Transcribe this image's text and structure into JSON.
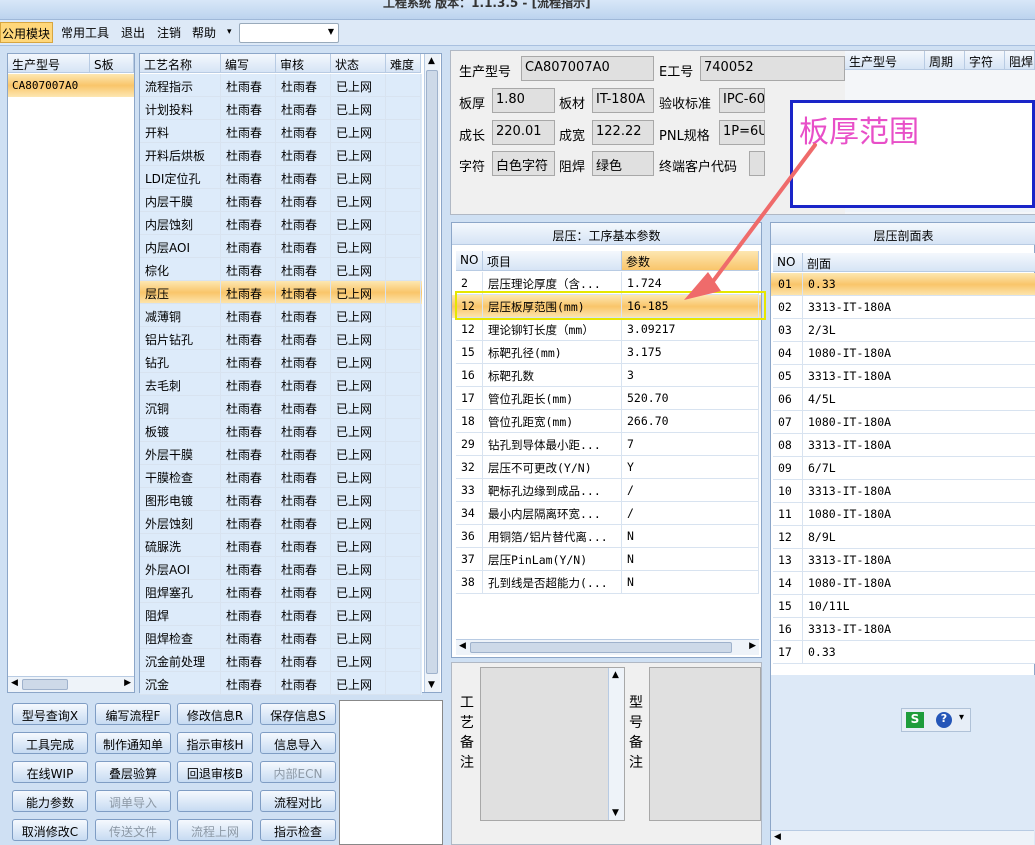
{
  "title": "工程系统 版本：1.1.3.5 - [流程指示]",
  "menu": {
    "items": [
      "公用模块",
      "常用工具",
      "退出",
      "注销",
      "帮助"
    ],
    "help_arrow": "▾"
  },
  "model_list": {
    "headers": [
      "生产型号",
      "S板"
    ],
    "items": [
      "CA807007A0"
    ]
  },
  "process": {
    "headers": [
      "工艺名称",
      "编写",
      "审核",
      "状态",
      "难度"
    ],
    "rows": [
      [
        "流程指示",
        "杜雨春",
        "杜雨春",
        "已上网"
      ],
      [
        "计划投料",
        "杜雨春",
        "杜雨春",
        "已上网"
      ],
      [
        "开料",
        "杜雨春",
        "杜雨春",
        "已上网"
      ],
      [
        "开料后烘板",
        "杜雨春",
        "杜雨春",
        "已上网"
      ],
      [
        "LDI定位孔",
        "杜雨春",
        "杜雨春",
        "已上网"
      ],
      [
        "内层干膜",
        "杜雨春",
        "杜雨春",
        "已上网"
      ],
      [
        "内层蚀刻",
        "杜雨春",
        "杜雨春",
        "已上网"
      ],
      [
        "内层AOI",
        "杜雨春",
        "杜雨春",
        "已上网"
      ],
      [
        "棕化",
        "杜雨春",
        "杜雨春",
        "已上网"
      ],
      [
        "层压",
        "杜雨春",
        "杜雨春",
        "已上网"
      ],
      [
        "减薄铜",
        "杜雨春",
        "杜雨春",
        "已上网"
      ],
      [
        "铝片钻孔",
        "杜雨春",
        "杜雨春",
        "已上网"
      ],
      [
        "钻孔",
        "杜雨春",
        "杜雨春",
        "已上网"
      ],
      [
        "去毛刺",
        "杜雨春",
        "杜雨春",
        "已上网"
      ],
      [
        "沉铜",
        "杜雨春",
        "杜雨春",
        "已上网"
      ],
      [
        "板镀",
        "杜雨春",
        "杜雨春",
        "已上网"
      ],
      [
        "外层干膜",
        "杜雨春",
        "杜雨春",
        "已上网"
      ],
      [
        "干膜检查",
        "杜雨春",
        "杜雨春",
        "已上网"
      ],
      [
        "图形电镀",
        "杜雨春",
        "杜雨春",
        "已上网"
      ],
      [
        "外层蚀刻",
        "杜雨春",
        "杜雨春",
        "已上网"
      ],
      [
        "硫脲洗",
        "杜雨春",
        "杜雨春",
        "已上网"
      ],
      [
        "外层AOI",
        "杜雨春",
        "杜雨春",
        "已上网"
      ],
      [
        "阻焊塞孔",
        "杜雨春",
        "杜雨春",
        "已上网"
      ],
      [
        "阻焊",
        "杜雨春",
        "杜雨春",
        "已上网"
      ],
      [
        "阻焊检查",
        "杜雨春",
        "杜雨春",
        "已上网"
      ],
      [
        "沉金前处理",
        "杜雨春",
        "杜雨春",
        "已上网"
      ],
      [
        "沉金",
        "杜雨春",
        "杜雨春",
        "已上网"
      ]
    ],
    "selected": 9
  },
  "buttons": [
    {
      "label": "型号查询X",
      "enabled": true
    },
    {
      "label": "编写流程F",
      "enabled": true
    },
    {
      "label": "修改信息R",
      "enabled": true
    },
    {
      "label": "保存信息S",
      "enabled": true
    },
    {
      "label": "工具完成",
      "enabled": true
    },
    {
      "label": "制作通知单",
      "enabled": true
    },
    {
      "label": "指示审核H",
      "enabled": true
    },
    {
      "label": "信息导入",
      "enabled": true
    },
    {
      "label": "在线WIP",
      "enabled": true
    },
    {
      "label": "叠层验算",
      "enabled": true
    },
    {
      "label": "回退审核B",
      "enabled": true
    },
    {
      "label": "内部ECN",
      "enabled": false
    },
    {
      "label": "能力参数",
      "enabled": true
    },
    {
      "label": "调单导入",
      "enabled": false
    },
    {
      "label": "",
      "enabled": true
    },
    {
      "label": "流程对比",
      "enabled": true
    },
    {
      "label": "取消修改C",
      "enabled": true
    },
    {
      "label": "传送文件",
      "enabled": false
    },
    {
      "label": "流程上网",
      "enabled": false
    },
    {
      "label": "指示检查",
      "enabled": true
    }
  ],
  "info": {
    "model_label": "生产型号",
    "model_value": "CA807007A0",
    "eno_label": "E工号",
    "eno_value": "740052",
    "thick_label": "板厚",
    "thick_value": "1.80",
    "mat_label": "板材",
    "mat_value": "IT-180A",
    "std_label": "验收标准",
    "std_value": "IPC-60",
    "len_label": "成长",
    "len_value": "220.01",
    "wid_label": "成宽",
    "wid_value": "122.22",
    "pnl_label": "PNL规格",
    "pnl_value": "1P=6U",
    "char_label": "字符",
    "char_value": "白色字符",
    "mask_label": "阻焊",
    "mask_value": "绿色",
    "cust_label": "终端客户代码",
    "cust_value": ""
  },
  "top_grid_headers": [
    "生产型号",
    "周期",
    "字符",
    "阻焊"
  ],
  "annotation": {
    "text": "板厚范围",
    "arrow_color": "#ef6b6b",
    "text_color": "#e84fc8",
    "box_color": "#1a25c8",
    "highlight_color": "#e6e600"
  },
  "params": {
    "title": "层压：工序基本参数",
    "headers": [
      "NO",
      "项目",
      "参数"
    ],
    "rows": [
      [
        "2",
        "层压理论厚度（含...",
        "1.724"
      ],
      [
        "12",
        "层压板厚范围(mm)",
        "16-185"
      ],
      [
        "12",
        "理论铆钉长度（mm）",
        "3.09217"
      ],
      [
        "15",
        "标靶孔径(mm)",
        "3.175"
      ],
      [
        "16",
        "标靶孔数",
        "3"
      ],
      [
        "17",
        "管位孔距长(mm)",
        "520.70"
      ],
      [
        "18",
        "管位孔距宽(mm)",
        "266.70"
      ],
      [
        "29",
        "钻孔到导体最小距...",
        "7"
      ],
      [
        "32",
        "层压不可更改(Y/N)",
        "Y"
      ],
      [
        "33",
        "靶标孔边缘到成品...",
        "/"
      ],
      [
        "34",
        "最小内层隔离环宽...",
        "/"
      ],
      [
        "36",
        "用铜箔/铝片替代离...",
        "N"
      ],
      [
        "37",
        "层压PinLam(Y/N)",
        "N"
      ],
      [
        "38",
        "孔到线是否超能力(...",
        "N"
      ]
    ],
    "selected": 1
  },
  "stack": {
    "title": "层压剖面表",
    "headers": [
      "NO",
      "剖面"
    ],
    "rows": [
      [
        "01",
        "0.33"
      ],
      [
        "02",
        "3313-IT-180A"
      ],
      [
        "03",
        "2/3L"
      ],
      [
        "04",
        "1080-IT-180A"
      ],
      [
        "05",
        "3313-IT-180A"
      ],
      [
        "06",
        "4/5L"
      ],
      [
        "07",
        "1080-IT-180A"
      ],
      [
        "08",
        "3313-IT-180A"
      ],
      [
        "09",
        "6/7L"
      ],
      [
        "10",
        "3313-IT-180A"
      ],
      [
        "11",
        "1080-IT-180A"
      ],
      [
        "12",
        "8/9L"
      ],
      [
        "13",
        "3313-IT-180A"
      ],
      [
        "14",
        "1080-IT-180A"
      ],
      [
        "15",
        "10/11L"
      ],
      [
        "16",
        "3313-IT-180A"
      ],
      [
        "17",
        "0.33"
      ]
    ],
    "selected": 0
  },
  "notes": {
    "process_label": "工\n艺\n备\n注",
    "model_label": "型\n号\n备\n注"
  },
  "tray": {
    "s_icon": "S",
    "help_icon": "?",
    "more": "▾"
  }
}
